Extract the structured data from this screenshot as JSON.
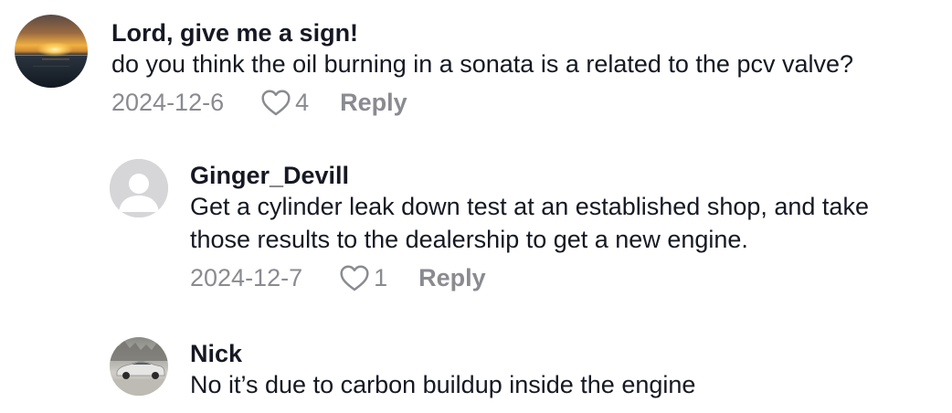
{
  "comments": [
    {
      "username": "Lord, give me a sign!",
      "text": "do you think the oil burning in a sonata is a related to the pcv valve?",
      "date": "2024-12-6",
      "likes": "4",
      "reply_label": "Reply",
      "avatar": "sunset-over-ocean-photo"
    },
    {
      "username": "Ginger_Devill",
      "text": "Get a cylinder leak down test at an established shop, and take\nthose results to the dealership to get a new engine.",
      "date": "2024-12-7",
      "likes": "1",
      "reply_label": "Reply",
      "avatar": "default-user-icon"
    },
    {
      "username": "Nick",
      "text": "No it’s due to carbon buildup inside the engine",
      "avatar": "silver-car-photo"
    }
  ],
  "colors": {
    "primary_text": "#161823",
    "secondary_text": "#8a8b91"
  },
  "icons": {
    "like": "heart-outline-icon"
  }
}
